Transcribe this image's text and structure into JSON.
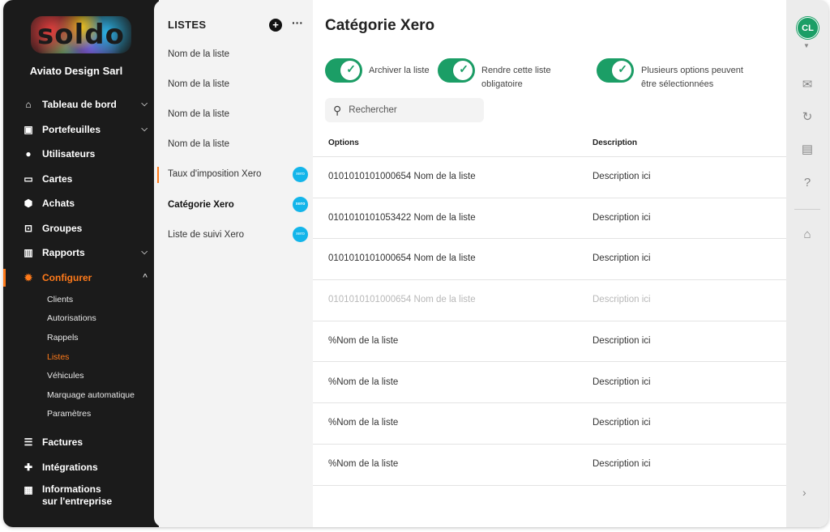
{
  "brand": {
    "logo": "soldo",
    "company": "Aviato Design Sarl"
  },
  "nav": [
    {
      "label": "Tableau de bord",
      "icon": "home-icon",
      "chevron": "⌄"
    },
    {
      "label": "Portefeuilles",
      "icon": "wallet-icon",
      "chevron": "⌄"
    },
    {
      "label": "Utilisateurs",
      "icon": "user-icon"
    },
    {
      "label": "Cartes",
      "icon": "card-icon"
    },
    {
      "label": "Achats",
      "icon": "hexagon-icon"
    },
    {
      "label": "Groupes",
      "icon": "group-icon"
    },
    {
      "label": "Rapports",
      "icon": "chart-icon",
      "chevron": "⌄"
    },
    {
      "label": "Configurer",
      "icon": "gear-icon",
      "chevron": "^"
    }
  ],
  "subnav": [
    "Clients",
    "Autorisations",
    "Rappels",
    "Listes",
    "Véhicules",
    "Marquage automatique",
    "Paramètres"
  ],
  "nav_bottom": [
    {
      "label": "Factures",
      "icon": "invoice-icon"
    },
    {
      "label": "Intégrations",
      "icon": "puzzle-icon"
    },
    {
      "label": "Informations sur l'entreprise",
      "line1": "Informations",
      "line2": "sur l'entreprise",
      "icon": "building-icon"
    }
  ],
  "lists": {
    "heading": "LISTES",
    "more": "···",
    "items": [
      {
        "label": "Nom de la liste"
      },
      {
        "label": "Nom de la liste"
      },
      {
        "label": "Nom de la liste"
      },
      {
        "label": "Nom de la liste"
      },
      {
        "label": "Taux d'imposition Xero",
        "badge": "xero"
      },
      {
        "label": "Catégorie Xero",
        "badge": "xero"
      },
      {
        "label": "Liste de suivi Xero",
        "badge": "xero"
      }
    ]
  },
  "main": {
    "title": "Catégorie Xero",
    "toggles": [
      {
        "label": "Archiver la liste",
        "on": true
      },
      {
        "label_line1": "Rendre cette liste",
        "label_line2": "obligatoire",
        "on": true
      },
      {
        "label_line1": "Plusieurs options peuvent",
        "label_line2": "être sélectionnées",
        "on": true
      }
    ],
    "search_placeholder": "Rechercher",
    "columns": [
      "Options",
      "Description"
    ],
    "rows": [
      {
        "option": "0101010101000654 Nom de la liste",
        "description": "Description ici",
        "disabled": false
      },
      {
        "option": "0101010101053422 Nom de la liste",
        "description": "Description ici",
        "disabled": false
      },
      {
        "option": "0101010101000654 Nom de la liste",
        "description": "Description ici",
        "disabled": false
      },
      {
        "option": "0101010101000654 Nom de la liste",
        "description": "Description ici",
        "disabled": true
      },
      {
        "option": "%Nom de la liste",
        "description": "Description ici",
        "disabled": false
      },
      {
        "option": "%Nom de la liste",
        "description": "Description ici",
        "disabled": false
      },
      {
        "option": "%Nom de la liste",
        "description": "Description ici",
        "disabled": false
      },
      {
        "option": "%Nom de la liste",
        "description": "Description ici",
        "disabled": false
      }
    ]
  },
  "rail": {
    "avatar": "CL",
    "accent": "#1b9e66",
    "brand_orange": "#ff7a1a"
  }
}
